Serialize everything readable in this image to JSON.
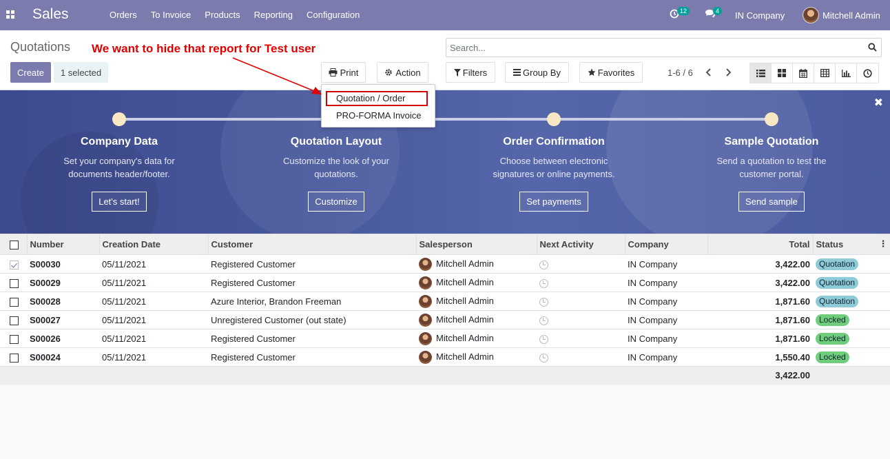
{
  "navbar": {
    "app_name": "Sales",
    "menu": [
      "Orders",
      "To Invoice",
      "Products",
      "Reporting",
      "Configuration"
    ],
    "activity_count": "12",
    "message_count": "4",
    "company": "IN Company",
    "user": "Mitchell Admin",
    "brand_color": "#7c7bad"
  },
  "control_panel": {
    "breadcrumb": "Quotations",
    "annotation": "We want to hide that report for Test user",
    "create_label": "Create",
    "selected_label": "1 selected",
    "print_label": "Print",
    "action_label": "Action",
    "search_placeholder": "Search...",
    "filters_label": "Filters",
    "groupby_label": "Group By",
    "favorites_label": "Favorites",
    "pager": "1-6 / 6"
  },
  "print_dropdown": {
    "items": [
      "Quotation / Order",
      "PRO-FORMA Invoice"
    ]
  },
  "onboarding": {
    "steps": [
      {
        "title": "Company Data",
        "desc1": "Set your company's data for",
        "desc2": "documents header/footer.",
        "button": "Let's start!"
      },
      {
        "title": "Quotation Layout",
        "desc1": "Customize the look of your",
        "desc2": "quotations.",
        "button": "Customize"
      },
      {
        "title": "Order Confirmation",
        "desc1": "Choose between electronic",
        "desc2": "signatures or online payments.",
        "button": "Set payments"
      },
      {
        "title": "Sample Quotation",
        "desc1": "Send a quotation to test the",
        "desc2": "customer portal.",
        "button": "Send sample"
      }
    ]
  },
  "table": {
    "headers": [
      "Number",
      "Creation Date",
      "Customer",
      "Salesperson",
      "Next Activity",
      "Company",
      "Total",
      "Status"
    ],
    "rows": [
      {
        "number": "S00030",
        "date": "05/11/2021",
        "customer": "Registered Customer",
        "salesperson": "Mitchell Admin",
        "company": "IN Company",
        "total": "3,422.00",
        "status": "Quotation",
        "checked": true
      },
      {
        "number": "S00029",
        "date": "05/11/2021",
        "customer": "Registered Customer",
        "salesperson": "Mitchell Admin",
        "company": "IN Company",
        "total": "3,422.00",
        "status": "Quotation",
        "checked": false
      },
      {
        "number": "S00028",
        "date": "05/11/2021",
        "customer": "Azure Interior, Brandon Freeman",
        "salesperson": "Mitchell Admin",
        "company": "IN Company",
        "total": "1,871.60",
        "status": "Quotation",
        "checked": false
      },
      {
        "number": "S00027",
        "date": "05/11/2021",
        "customer": "Unregistered Customer (out state)",
        "salesperson": "Mitchell Admin",
        "company": "IN Company",
        "total": "1,871.60",
        "status": "Locked",
        "checked": false
      },
      {
        "number": "S00026",
        "date": "05/11/2021",
        "customer": "Registered Customer",
        "salesperson": "Mitchell Admin",
        "company": "IN Company",
        "total": "1,871.60",
        "status": "Locked",
        "checked": false
      },
      {
        "number": "S00024",
        "date": "05/11/2021",
        "customer": "Registered Customer",
        "salesperson": "Mitchell Admin",
        "company": "IN Company",
        "total": "1,550.40",
        "status": "Locked",
        "checked": false
      }
    ],
    "footer_total": "3,422.00"
  }
}
